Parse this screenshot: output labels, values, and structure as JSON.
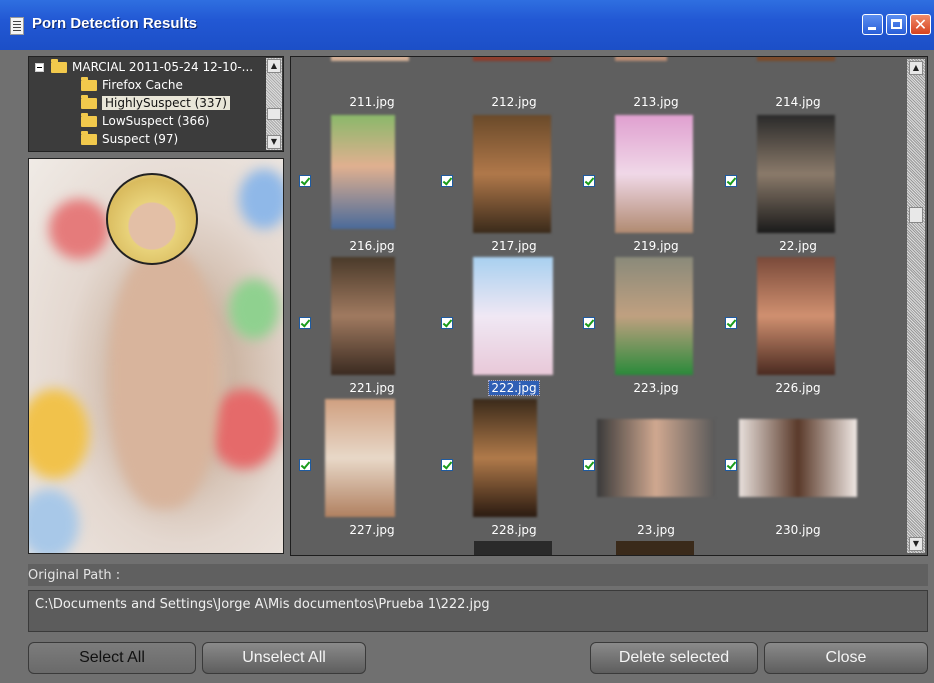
{
  "window": {
    "title": "Porn Detection Results"
  },
  "tree": {
    "root": "MARCIAL 2011-05-24 12-10-...",
    "items": [
      {
        "label": "Firefox Cache",
        "selected": false
      },
      {
        "label": "HighlySuspect (337)",
        "selected": true
      },
      {
        "label": "LowSuspect (366)",
        "selected": false
      },
      {
        "label": "Suspect (97)",
        "selected": false
      }
    ]
  },
  "thumbnails": [
    {
      "name": "211.jpg",
      "checked": false
    },
    {
      "name": "212.jpg",
      "checked": false
    },
    {
      "name": "213.jpg",
      "checked": false
    },
    {
      "name": "214.jpg",
      "checked": false
    },
    {
      "name": "216.jpg",
      "checked": true
    },
    {
      "name": "217.jpg",
      "checked": true
    },
    {
      "name": "219.jpg",
      "checked": true
    },
    {
      "name": "22.jpg",
      "checked": true
    },
    {
      "name": "221.jpg",
      "checked": true
    },
    {
      "name": "222.jpg",
      "checked": true,
      "selected": true
    },
    {
      "name": "223.jpg",
      "checked": true
    },
    {
      "name": "226.jpg",
      "checked": true
    },
    {
      "name": "227.jpg",
      "checked": true
    },
    {
      "name": "228.jpg",
      "checked": true
    },
    {
      "name": "23.jpg",
      "checked": true
    },
    {
      "name": "230.jpg",
      "checked": true
    }
  ],
  "path": {
    "label": "Original Path :",
    "value": "C:\\Documents and Settings\\Jorge A\\Mis documentos\\Prueba 1\\222.jpg"
  },
  "buttons": {
    "select_all": "Select All",
    "unselect_all": "Unselect All",
    "delete_selected": "Delete selected",
    "close": "Close"
  },
  "colors": {
    "titlebar": "#2258d4",
    "background": "#707070",
    "selection": "#2f5fb5"
  }
}
